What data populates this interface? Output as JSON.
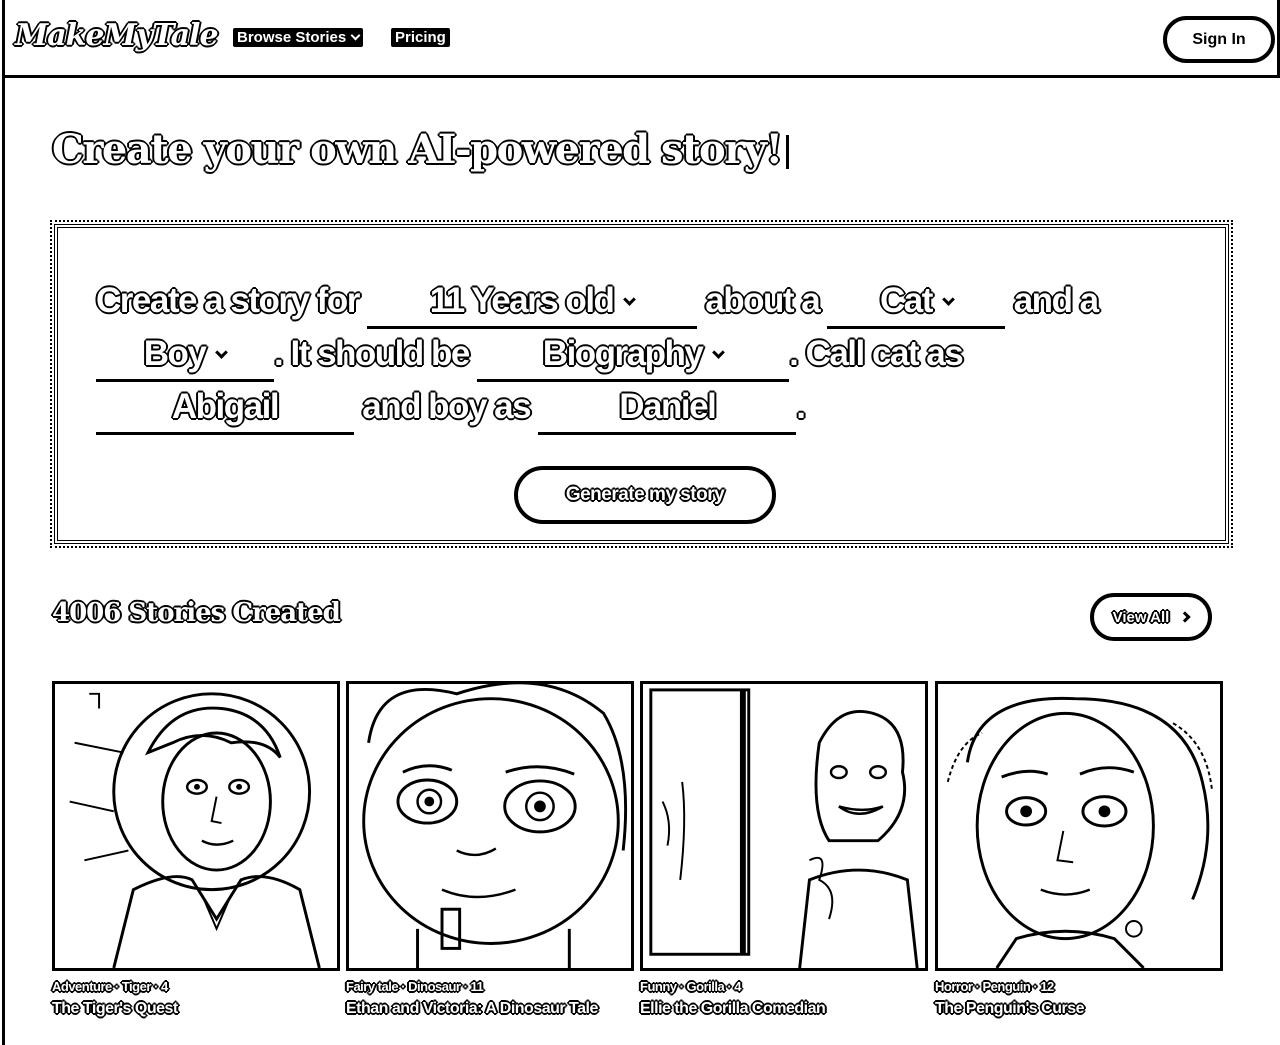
{
  "header": {
    "logo": "MakeMyTale",
    "nav": {
      "browse": "Browse Stories",
      "pricing": "Pricing"
    },
    "signin": "Sign In"
  },
  "hero": {
    "title": "Create your own AI-powered story!",
    "sentence": {
      "p1": "Create a story for",
      "age": "11 Years old",
      "p2": "about a",
      "animal": "Cat",
      "p3": "and a",
      "person": "Boy",
      "p4": ".",
      "p5": "It should be",
      "genre": "Biography",
      "p6": ".",
      "p7": "Call  cat as",
      "animal_name": "Abigail",
      "p8": "and boy as",
      "person_name": "Daniel",
      "p9": "."
    },
    "generate_button": "Generate my story"
  },
  "stories": {
    "count_text": "4006 Stories Created",
    "view_all": "View All",
    "cards": [
      {
        "meta": "Adventure · Tiger · 4",
        "title": "The Tiger's Quest"
      },
      {
        "meta": "Fairy tale · Dinosaur · 11",
        "title": "Ethan and Victoria: A Dinosaur Tale"
      },
      {
        "meta": "Funny · Gorilla · 4",
        "title": "Ellie the Gorilla Comedian"
      },
      {
        "meta": "Horror · Penguin · 12",
        "title": "The Penguin's Curse"
      }
    ]
  }
}
